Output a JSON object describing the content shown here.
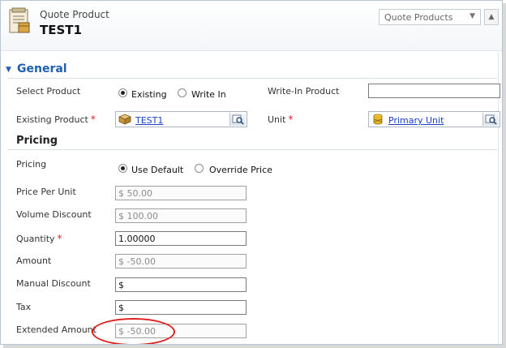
{
  "header": {
    "entity_type": "Quote Product",
    "record_name": "TEST1",
    "form_selector": "Quote Products",
    "icon": "quote-product-icon"
  },
  "section": {
    "title": "General",
    "toggle_icon": "collapse-triangle-icon"
  },
  "fields": {
    "select_product": {
      "label": "Select Product",
      "options": [
        "Existing",
        "Write In"
      ],
      "selected": "Existing"
    },
    "write_in_product": {
      "label": "Write-In Product",
      "value": ""
    },
    "existing_product": {
      "label": "Existing Product",
      "required_mark": "*",
      "value": "TEST1",
      "icon": "product-box-icon"
    },
    "unit": {
      "label": "Unit",
      "required_mark": "*",
      "value": "Primary Unit",
      "icon": "unit-stack-icon"
    }
  },
  "pricing": {
    "title": "Pricing",
    "pricing_label": "Pricing",
    "options": [
      "Use Default",
      "Override Price"
    ],
    "selected": "Use Default",
    "price_per_unit": {
      "label": "Price Per Unit",
      "value": "$ 50.00"
    },
    "volume_discount": {
      "label": "Volume Discount",
      "value": "$ 100.00"
    },
    "quantity": {
      "label": "Quantity",
      "required_mark": "*",
      "value": "1.00000"
    },
    "amount": {
      "label": "Amount",
      "value": "$ -50.00"
    },
    "manual_discount": {
      "label": "Manual Discount",
      "value": "$"
    },
    "tax": {
      "label": "Tax",
      "value": "$"
    },
    "extended_amount": {
      "label": "Extended Amount",
      "value": "$ -50.00"
    }
  },
  "colors": {
    "accent": "#1f5fb0",
    "required": "#e02020",
    "link": "#1a3fc4",
    "highlight": "#e02020"
  }
}
